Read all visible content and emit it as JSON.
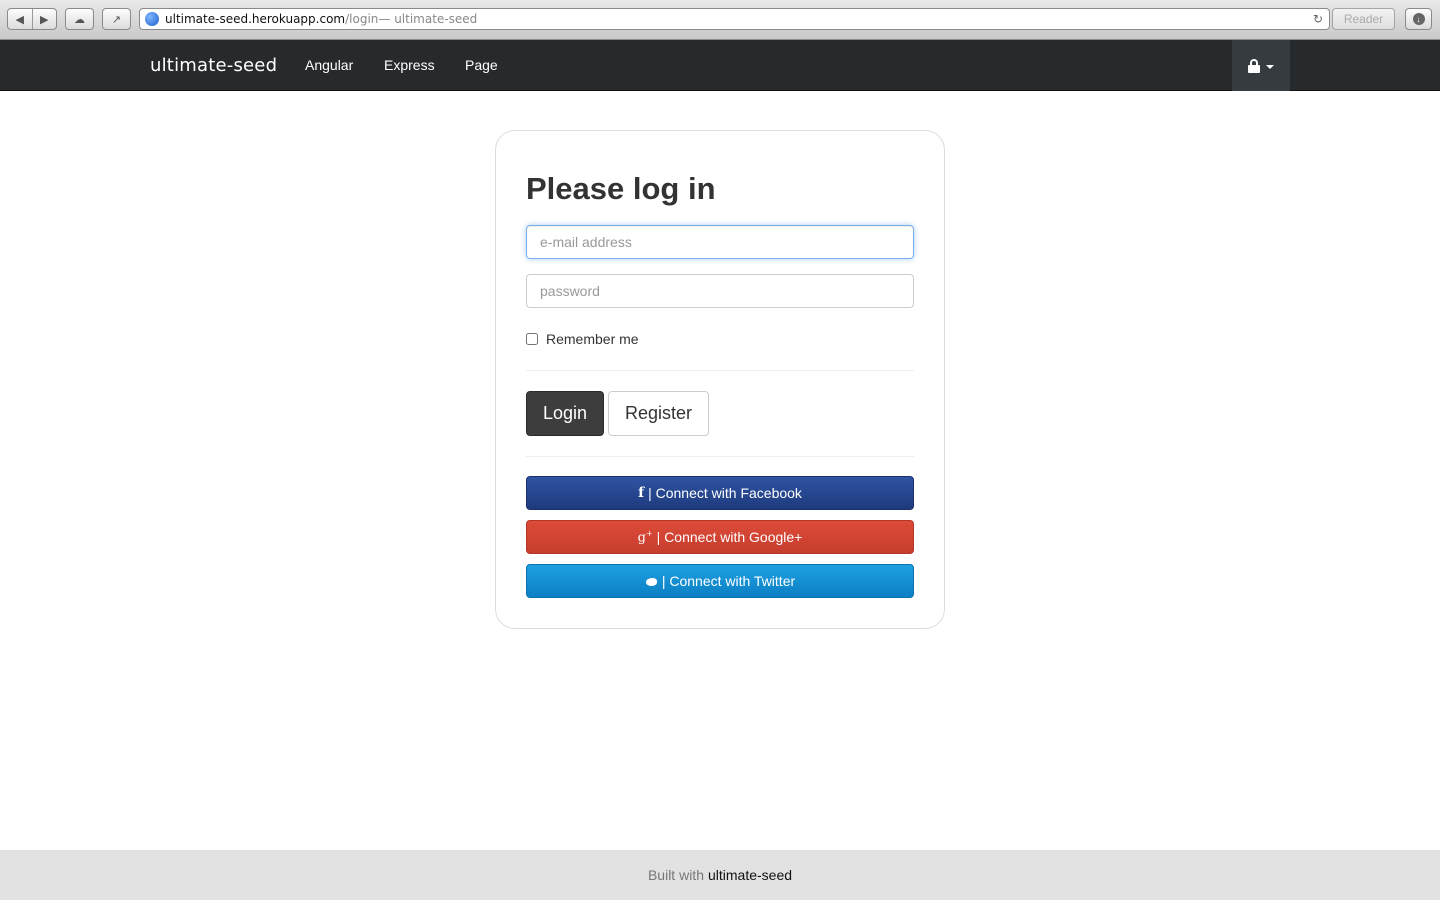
{
  "browser": {
    "url_host": "ultimate-seed.herokuapp.com",
    "url_path": "/login",
    "page_title_suffix": " — ultimate-seed",
    "reader_label": "Reader",
    "back_glyph": "◀",
    "forward_glyph": "▶",
    "reload_glyph": "↻"
  },
  "navbar": {
    "brand": "ultimate-seed",
    "links": [
      "Angular",
      "Express",
      "Page"
    ]
  },
  "login": {
    "title": "Please log in",
    "email_placeholder": "e-mail address",
    "password_placeholder": "password",
    "remember_label": "Remember me",
    "login_label": "Login",
    "register_label": "Register",
    "facebook_label": "| Connect with Facebook",
    "google_label": "| Connect with Google+",
    "twitter_label": "| Connect with Twitter",
    "facebook_glyph": "f",
    "google_glyph": "g"
  },
  "footer": {
    "prefix": "Built with",
    "link": "ultimate-seed"
  },
  "colors": {
    "navbar_bg": "#262a2d",
    "facebook": "#2f54a3",
    "google": "#dd4b39",
    "twitter": "#1ea0e1",
    "login_btn": "#3d3d3d"
  },
  "icons": {
    "lock": "lock-icon",
    "caret": "caret-down-icon",
    "facebook": "facebook-icon",
    "google": "google-plus-icon",
    "twitter": "twitter-icon"
  }
}
